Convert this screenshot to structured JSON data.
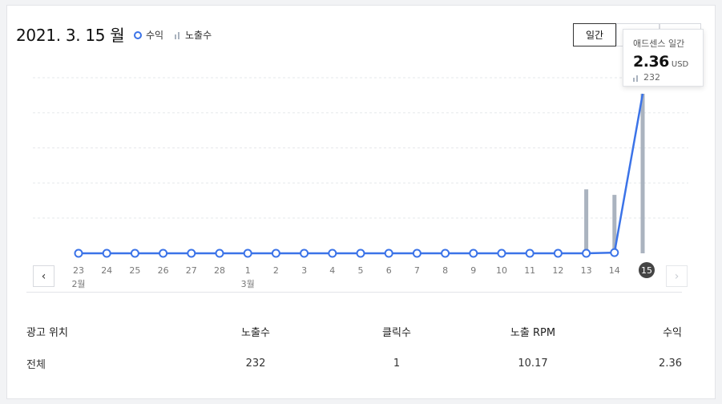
{
  "header": {
    "date_title": "2021. 3. 15 월",
    "legend_revenue": "수익",
    "legend_impressions": "노출수"
  },
  "period_buttons": [
    {
      "label": "일간",
      "active": true
    },
    {
      "label": "",
      "active": false
    },
    {
      "label": "",
      "active": false
    }
  ],
  "tooltip": {
    "title": "애드센스 일간",
    "value": "2.36",
    "unit": "USD",
    "impressions": "232"
  },
  "chart_data": {
    "type": "line",
    "x": [
      "23",
      "24",
      "25",
      "26",
      "27",
      "28",
      "1",
      "2",
      "3",
      "4",
      "5",
      "6",
      "7",
      "8",
      "9",
      "10",
      "11",
      "12",
      "13",
      "14",
      "15"
    ],
    "month_labels": [
      {
        "index": 0,
        "label": "2월"
      },
      {
        "index": 6,
        "label": "3월"
      }
    ],
    "selected_index": 20,
    "series": [
      {
        "name": "수익",
        "kind": "line",
        "color": "#3b73e8",
        "values": [
          0,
          0,
          0,
          0,
          0,
          0,
          0,
          0,
          0,
          0,
          0,
          0,
          0,
          0,
          0,
          0,
          0,
          0,
          0,
          0.01,
          2.36
        ]
      },
      {
        "name": "노출수",
        "kind": "bar",
        "color": "#aab3bf",
        "values": [
          0,
          0,
          0,
          0,
          0,
          0,
          0,
          0,
          0,
          0,
          0,
          0,
          0,
          0,
          0,
          0,
          0,
          0,
          93,
          85,
          232
        ]
      }
    ],
    "ylim_revenue": [
      0,
      2.36
    ],
    "ylim_impressions": [
      0,
      232
    ],
    "grid": true
  },
  "table": {
    "headers": [
      "광고 위치",
      "노출수",
      "클릭수",
      "노출 RPM",
      "수익"
    ],
    "rows": [
      [
        "전체",
        "232",
        "1",
        "10.17",
        "2.36"
      ]
    ]
  },
  "nav": {
    "prev_icon": "chevron-left-icon",
    "next_icon": "chevron-right-icon"
  }
}
